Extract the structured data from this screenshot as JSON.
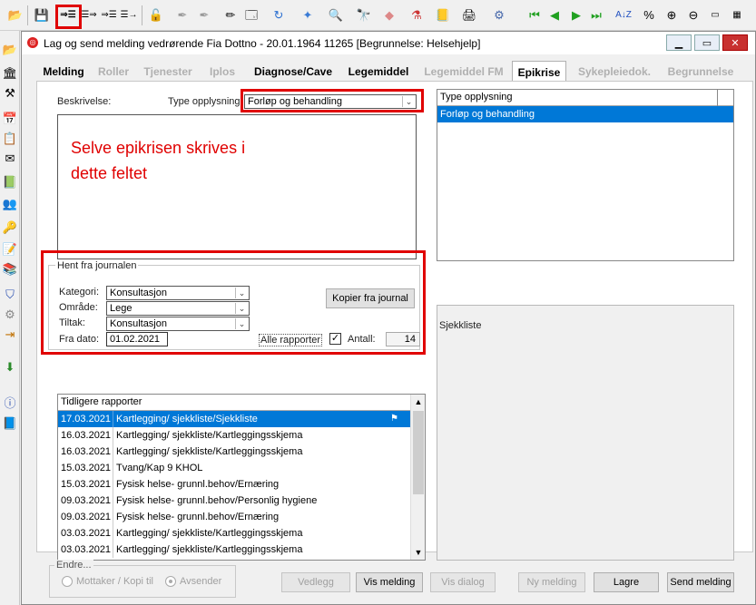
{
  "window": {
    "title": "Lag og send melding vedrørende Fia Dottno  -  20.01.1964  11265   [Begrunnelse: Helsehjelp]"
  },
  "tabs": [
    {
      "label": "Melding",
      "state": "enabled"
    },
    {
      "label": "Roller",
      "state": "disabled"
    },
    {
      "label": "Tjenester",
      "state": "disabled"
    },
    {
      "label": "Iplos",
      "state": "disabled"
    },
    {
      "label": "Diagnose/Cave",
      "state": "enabled"
    },
    {
      "label": "Legemiddel",
      "state": "enabled"
    },
    {
      "label": "Legemiddel FM",
      "state": "disabled"
    },
    {
      "label": "Epikrise",
      "state": "active"
    },
    {
      "label": "Sykepleiedok.",
      "state": "disabled"
    },
    {
      "label": "Begrunnelse",
      "state": "disabled"
    }
  ],
  "epikrise": {
    "beskrivelse_label": "Beskrivelse:",
    "type_label": "Type opplysning:",
    "type_value": "Forløp og behandling",
    "editor_annotation_line1": "Selve epikrisen skrives i",
    "editor_annotation_line2": "dette feltet",
    "type_list_header": "Type opplysning",
    "type_list_items": [
      "Forløp og behandling"
    ],
    "sjekkliste_label": "Sjekkliste"
  },
  "hent": {
    "group_label": "Hent fra journalen",
    "kategori_label": "Kategori:",
    "kategori_value": "Konsultasjon",
    "omrade_label": "Område:",
    "omrade_value": "Lege",
    "tiltak_label": "Tiltak:",
    "tiltak_value": "Konsultasjon",
    "fra_dato_label": "Fra dato:",
    "fra_dato_value": "01.02.2021",
    "kopier_button": "Kopier fra journal",
    "alle_rapporter_label": "Alle rapporter",
    "antall_label": "Antall:",
    "antall_value": "14"
  },
  "rapporter": {
    "header": "Tidligere rapporter",
    "rows": [
      {
        "date": "17.03.2021",
        "text": "Kartlegging/ sjekkliste/Sjekkliste"
      },
      {
        "date": "16.03.2021",
        "text": "Kartlegging/ sjekkliste/Kartleggingsskjema"
      },
      {
        "date": "16.03.2021",
        "text": "Kartlegging/ sjekkliste/Kartleggingsskjema"
      },
      {
        "date": "15.03.2021",
        "text": "Tvang/Kap 9 KHOL"
      },
      {
        "date": "15.03.2021",
        "text": "Fysisk helse- grunnl.behov/Ernæring"
      },
      {
        "date": "09.03.2021",
        "text": "Fysisk helse- grunnl.behov/Personlig hygiene"
      },
      {
        "date": "09.03.2021",
        "text": "Fysisk helse- grunnl.behov/Ernæring"
      },
      {
        "date": "03.03.2021",
        "text": "Kartlegging/ sjekkliste/Kartleggingsskjema"
      },
      {
        "date": "03.03.2021",
        "text": "Kartlegging/ sjekkliste/Kartleggingsskjema"
      }
    ]
  },
  "endre": {
    "group_label": "Endre...",
    "mottaker_label": "Mottaker / Kopi til",
    "avsender_label": "Avsender"
  },
  "buttons": {
    "vedlegg": "Vedlegg",
    "vis_melding": "Vis melding",
    "vis_dialog": "Vis dialog",
    "ny_melding": "Ny melding",
    "lagre": "Lagre",
    "send_melding": "Send melding"
  },
  "colors": {
    "selection": "#0078d7",
    "highlight_box": "#e00000",
    "annotation_text": "#e00000"
  }
}
